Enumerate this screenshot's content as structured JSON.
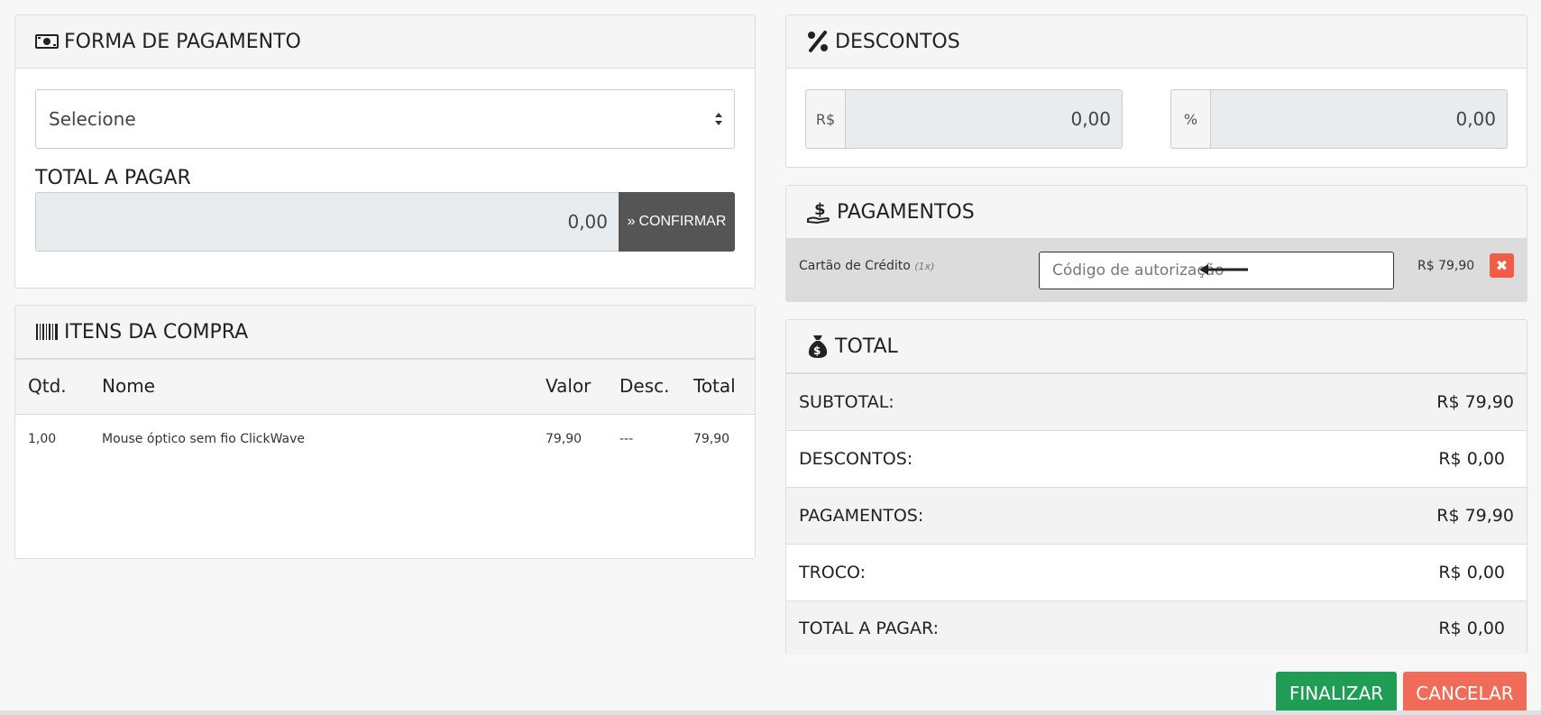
{
  "forma_pagamento": {
    "title": "FORMA DE PAGAMENTO",
    "select_value": "Selecione",
    "total_label": "TOTAL A PAGAR",
    "total_value": "0,00",
    "confirm_label": "CONFIRMAR"
  },
  "itens": {
    "title": "ITENS DA COMPRA",
    "columns": [
      "Qtd.",
      "Nome",
      "Valor",
      "Desc.",
      "Total"
    ],
    "rows": [
      {
        "qtd": "1,00",
        "nome": "Mouse óptico sem fio ClickWave",
        "valor": "79,90",
        "desc": "---",
        "total": "79,90"
      }
    ]
  },
  "descontos": {
    "title": "DESCONTOS",
    "currency_addon": "R$",
    "currency_value": "0,00",
    "percent_addon": "%",
    "percent_value": "0,00"
  },
  "pagamentos": {
    "title": "PAGAMENTOS",
    "items": [
      {
        "method": "Cartão de Crédito",
        "installments": "(1x)",
        "auth_placeholder": "Código de autorização",
        "value": "R$ 79,90"
      }
    ]
  },
  "total": {
    "title": "TOTAL",
    "rows": [
      {
        "label": "SUBTOTAL:",
        "value": "R$ 79,90"
      },
      {
        "label": "DESCONTOS:",
        "value": "R$ 0,00"
      },
      {
        "label": "PAGAMENTOS:",
        "value": "R$ 79,90"
      },
      {
        "label": "TROCO:",
        "value": "R$ 0,00"
      },
      {
        "label": "TOTAL A PAGAR:",
        "value": "R$ 0,00"
      }
    ]
  },
  "actions": {
    "finalizar": "FINALIZAR",
    "cancelar": "CANCELAR"
  },
  "icons": {
    "forma": "money-bill-icon",
    "itens": "barcode-icon",
    "descontos": "percent-icon",
    "pagamentos": "hand-dollar-icon",
    "total": "money-bag-icon"
  },
  "colors": {
    "confirm": "#555555",
    "finalizar": "#1f9d55",
    "cancelar": "#f06b58",
    "remove": "#f05c45"
  }
}
